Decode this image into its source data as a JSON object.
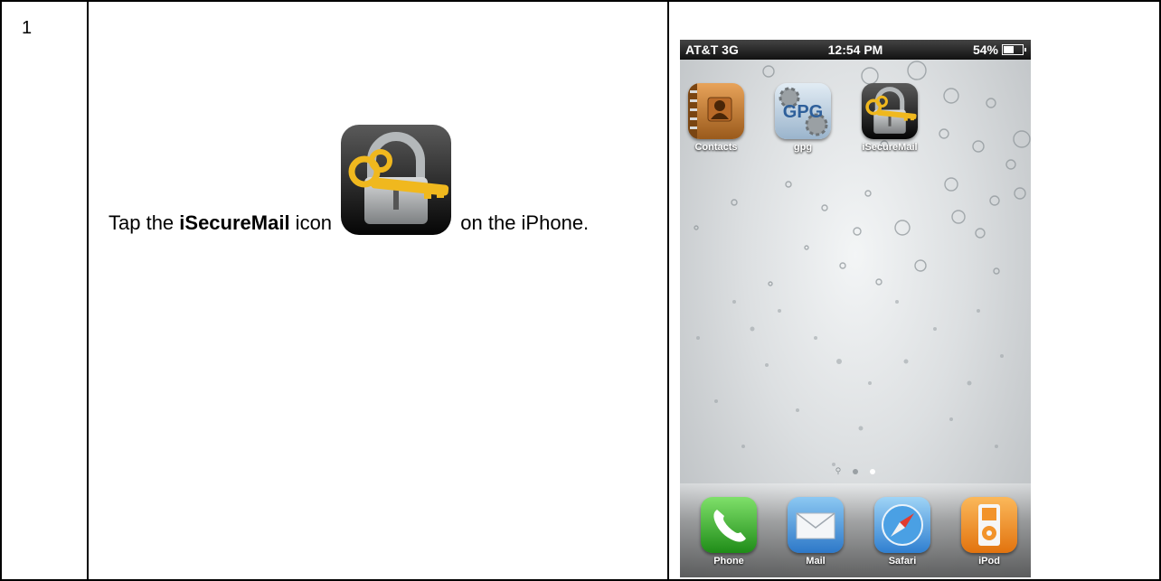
{
  "step": {
    "number": "1",
    "text_before": "Tap the ",
    "app_name": "iSecureMail",
    "text_middle": " icon ",
    "text_after": " on the iPhone."
  },
  "phone": {
    "status": {
      "carrier": "AT&T 3G",
      "time": "12:54 PM",
      "battery": "54%",
      "battery_level": 0.54
    },
    "home_apps": [
      {
        "label": "Contacts",
        "icon": "contacts-icon"
      },
      {
        "label": "gpg",
        "icon": "gpg-icon"
      },
      {
        "label": "iSecureMail",
        "icon": "lock-key-icon"
      }
    ],
    "dock_apps": [
      {
        "label": "Phone",
        "icon": "phone-icon"
      },
      {
        "label": "Mail",
        "icon": "mail-icon"
      },
      {
        "label": "Safari",
        "icon": "compass-icon"
      },
      {
        "label": "iPod",
        "icon": "ipod-icon"
      }
    ],
    "gpg_icon_text": "GPG",
    "page_indicator": {
      "pages": 2,
      "active": 2
    }
  },
  "colors": {
    "key_gold": "#f0b81e",
    "lock_gray": "#a8acad",
    "phone_green": "#3fb12e",
    "mail_blue": "#3f8fdc",
    "ipod_orange": "#f28a1c"
  }
}
